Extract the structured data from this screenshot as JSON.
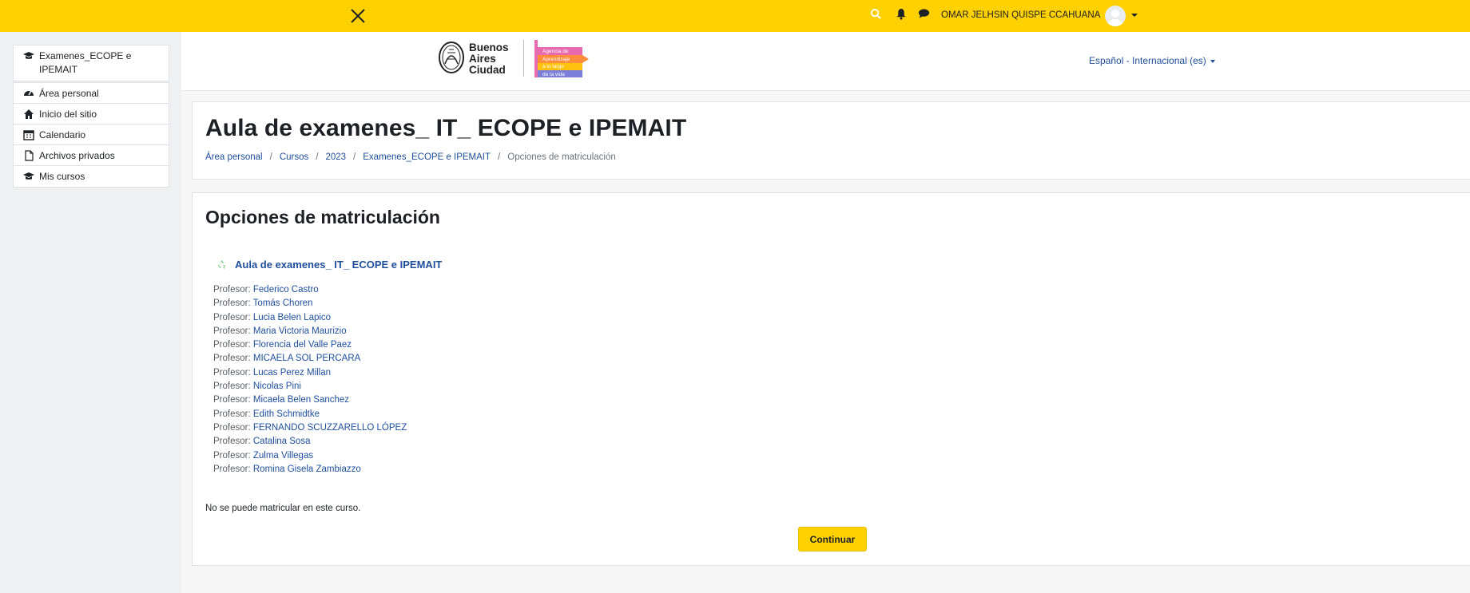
{
  "topbar": {
    "user_name": "OMAR JELHSIN QUISPE CCAHUANA",
    "icons": [
      "close-icon",
      "search-icon",
      "bell-icon",
      "chat-icon"
    ],
    "accent_color": "#ffd100"
  },
  "sidebar": {
    "course": "Examenes_ECOPE e IPEMAIT",
    "items": [
      {
        "label": "Área personal",
        "icon": "dashboard-icon"
      },
      {
        "label": "Inicio del sitio",
        "icon": "home-icon"
      },
      {
        "label": "Calendario",
        "icon": "calendar-icon"
      },
      {
        "label": "Archivos privados",
        "icon": "file-icon"
      },
      {
        "label": "Mis cursos",
        "icon": "graduation-cap-icon"
      }
    ]
  },
  "header": {
    "logo_text_1": "Buenos",
    "logo_text_2": "Aires",
    "logo_text_3": "Ciudad",
    "agency_lines": [
      "Agencia de",
      "Aprendizaje",
      "a lo largo",
      "de la vida"
    ],
    "language": "Español - Internacional (es)"
  },
  "page": {
    "title": "Aula de examenes_ IT_ ECOPE e IPEMAIT",
    "breadcrumb": [
      "Área personal",
      "Cursos",
      "2023",
      "Examenes_ECOPE e IPEMAIT"
    ],
    "breadcrumb_current": "Opciones de matriculación"
  },
  "enrol": {
    "heading": "Opciones de matriculación",
    "course_name": "Aula de examenes_ IT_ ECOPE e IPEMAIT",
    "teacher_label": "Profesor:",
    "teachers": [
      "Federico Castro",
      "Tomás Choren",
      "Lucia Belen Lapico",
      "Maria Victoria Maurizio",
      "Florencia del Valle Paez",
      "MICAELA SOL PERCARA",
      "Lucas Perez Millan",
      "Nicolas Pini",
      "Micaela Belen Sanchez",
      "Edith Schmidtke",
      "FERNANDO SCUZZARELLO LÓPEZ",
      "Catalina Sosa",
      "Zulma Villegas",
      "Romina Gisela Zambiazzo"
    ],
    "message": "No se puede matricular en este curso.",
    "continue_label": "Continuar"
  }
}
